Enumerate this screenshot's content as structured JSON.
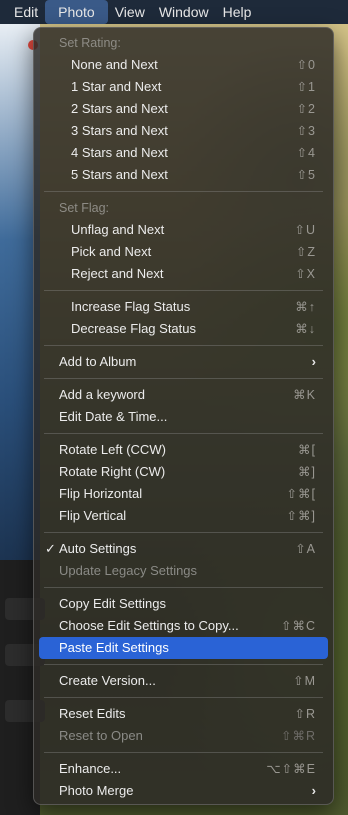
{
  "menubar": {
    "items": [
      "Edit",
      "Photo",
      "View",
      "Window",
      "Help"
    ],
    "active": "Photo"
  },
  "menu": {
    "set_rating_header": "Set Rating:",
    "rating": [
      {
        "label": "None and Next",
        "shortcut": "⇧0"
      },
      {
        "label": "1 Star and Next",
        "shortcut": "⇧1"
      },
      {
        "label": "2 Stars and Next",
        "shortcut": "⇧2"
      },
      {
        "label": "3 Stars and Next",
        "shortcut": "⇧3"
      },
      {
        "label": "4 Stars and Next",
        "shortcut": "⇧4"
      },
      {
        "label": "5 Stars and Next",
        "shortcut": "⇧5"
      }
    ],
    "set_flag_header": "Set Flag:",
    "flag": [
      {
        "label": "Unflag and Next",
        "shortcut": "⇧U"
      },
      {
        "label": "Pick and Next",
        "shortcut": "⇧Z"
      },
      {
        "label": "Reject and Next",
        "shortcut": "⇧X"
      }
    ],
    "flag_status": [
      {
        "label": "Increase Flag Status",
        "shortcut": "⌘↑"
      },
      {
        "label": "Decrease Flag Status",
        "shortcut": "⌘↓"
      }
    ],
    "add_to_album": "Add to Album",
    "add_keyword": {
      "label": "Add a keyword",
      "shortcut": "⌘K"
    },
    "edit_date_time": "Edit Date & Time...",
    "rotate": [
      {
        "label": "Rotate Left (CCW)",
        "shortcut": "⌘["
      },
      {
        "label": "Rotate Right (CW)",
        "shortcut": "⌘]"
      },
      {
        "label": "Flip Horizontal",
        "shortcut": "⇧⌘["
      },
      {
        "label": "Flip Vertical",
        "shortcut": "⇧⌘]"
      }
    ],
    "auto_settings": {
      "label": "Auto Settings",
      "shortcut": "⇧A",
      "check": "✓"
    },
    "update_legacy": "Update Legacy Settings",
    "copy_edit": "Copy Edit Settings",
    "choose_edit": {
      "label": "Choose Edit Settings to Copy...",
      "shortcut": "⇧⌘C"
    },
    "paste_edit": "Paste Edit Settings",
    "create_version": {
      "label": "Create Version...",
      "shortcut": "⇧M"
    },
    "reset_edits": {
      "label": "Reset Edits",
      "shortcut": "⇧R"
    },
    "reset_to_open": {
      "label": "Reset to Open",
      "shortcut": "⇧⌘R"
    },
    "enhance": {
      "label": "Enhance...",
      "shortcut": "⌥⇧⌘E"
    },
    "photo_merge": "Photo Merge",
    "submenu_arrow": "›"
  },
  "colors": {
    "menubar_bg": "#1e2a3a",
    "selected": "#2a63d6",
    "menu_bg": "#2c2a26"
  }
}
